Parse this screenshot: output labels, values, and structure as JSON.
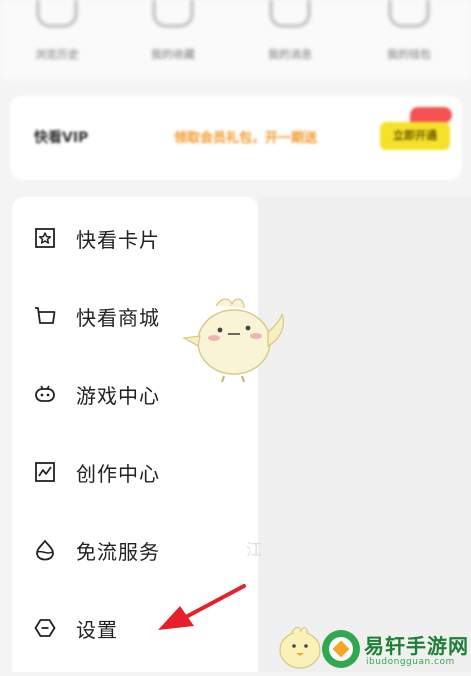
{
  "top_row": {
    "items": [
      {
        "label": "浏览历史",
        "icon": "history-icon"
      },
      {
        "label": "我的收藏",
        "icon": "collection-icon"
      },
      {
        "label": "我的消息",
        "icon": "message-icon"
      },
      {
        "label": "我的钱包",
        "icon": "wallet-icon"
      }
    ]
  },
  "vip_banner": {
    "title": "快看VIP",
    "promo": "领取会员礼包，开一期送",
    "button": "立即开通",
    "accent": "#f6e12a",
    "promo_color": "#f39a2a"
  },
  "menu": {
    "items": [
      {
        "label": "快看卡片",
        "icon": "card-icon"
      },
      {
        "label": "快看商城",
        "icon": "cart-icon"
      },
      {
        "label": "游戏中心",
        "icon": "gamepad-icon"
      },
      {
        "label": "创作中心",
        "icon": "chart-icon"
      },
      {
        "label": "免流服务",
        "icon": "water-drop-icon"
      },
      {
        "label": "设置",
        "icon": "settings-icon"
      }
    ]
  },
  "ghost_text": "江",
  "watermark": {
    "title": "易轩手游网",
    "url": "ibudongguan.com",
    "color": "#2fa84f"
  },
  "annotation": {
    "color": "#e5202a",
    "target": "设置"
  }
}
